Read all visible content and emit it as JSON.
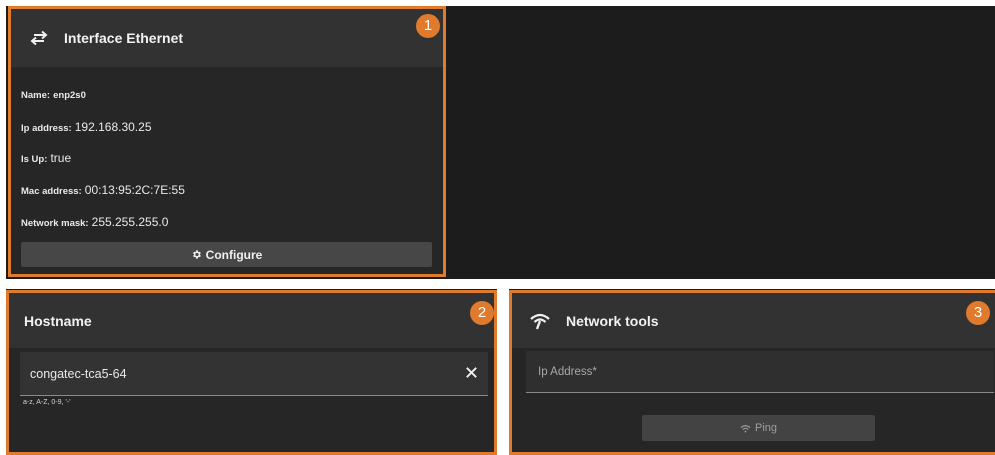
{
  "ethernet_card": {
    "title": "Interface Ethernet",
    "badge": "1",
    "fields": [
      {
        "label": "Name:",
        "value": "enp2s0"
      },
      {
        "label": "Ip address:",
        "value": "192.168.30.25"
      },
      {
        "label": "Is Up:",
        "value": "true"
      },
      {
        "label": "Mac address:",
        "value": "00:13:95:2C:7E:55"
      },
      {
        "label": "Network mask:",
        "value": "255.255.255.0"
      }
    ],
    "configure_label": "Configure"
  },
  "hostname_card": {
    "title": "Hostname",
    "badge": "2",
    "value": "congatec-tca5-64",
    "helper": "a-z, A-Z, 0-9, '-'"
  },
  "network_tools_card": {
    "title": "Network tools",
    "badge": "3",
    "ip_placeholder": "Ip Address*",
    "ping_label": "Ping"
  },
  "icons": {
    "ethernet": "swap-arrows-icon",
    "configure": "gear-icon",
    "clear": "close-icon",
    "network": "wifi-icon",
    "ping": "wifi-icon"
  },
  "colors": {
    "accent": "#e07a2c",
    "card_bg": "#262626",
    "header_bg": "#323232",
    "page_bg": "#1c1c1c"
  }
}
